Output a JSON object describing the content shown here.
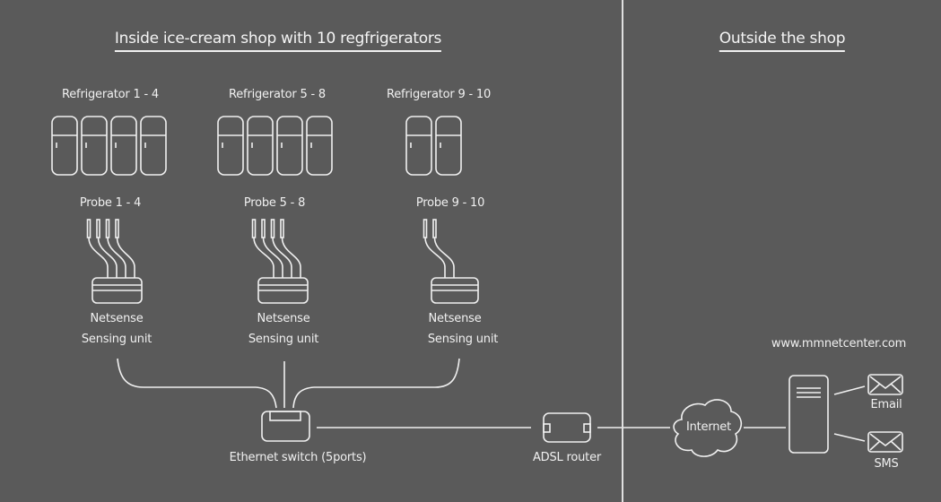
{
  "sections": {
    "inside": {
      "title": "Inside ice-cream shop with 10 regfrigerators"
    },
    "outside": {
      "title": "Outside the shop"
    }
  },
  "groups": [
    {
      "refrigerator_label": "Refrigerator 1 - 4",
      "refrigerator_count": 4,
      "probe_label": "Probe 1 - 4",
      "probe_count": 4,
      "unit_name": "Netsense",
      "unit_type": "Sensing unit"
    },
    {
      "refrigerator_label": "Refrigerator 5 - 8",
      "refrigerator_count": 4,
      "probe_label": "Probe 5 - 8",
      "probe_count": 4,
      "unit_name": "Netsense",
      "unit_type": "Sensing unit"
    },
    {
      "refrigerator_label": "Refrigerator 9 - 10",
      "refrigerator_count": 2,
      "probe_label": "Probe 9 - 10",
      "probe_count": 2,
      "unit_name": "Netsense",
      "unit_type": "Sensing unit"
    }
  ],
  "network": {
    "switch_label": "Ethernet switch (5ports)",
    "router_label": "ADSL router",
    "internet_label": "Internet",
    "server_label": "www.mmnetcenter.com",
    "email_label": "Email",
    "sms_label": "SMS"
  },
  "icons": {
    "refrigerator": "refrigerator-icon",
    "probe": "probe-icon",
    "sensing_unit": "sensing-unit-icon",
    "switch": "ethernet-switch-icon",
    "router": "router-icon",
    "cloud": "cloud-icon",
    "server": "server-icon",
    "envelope": "envelope-icon"
  }
}
